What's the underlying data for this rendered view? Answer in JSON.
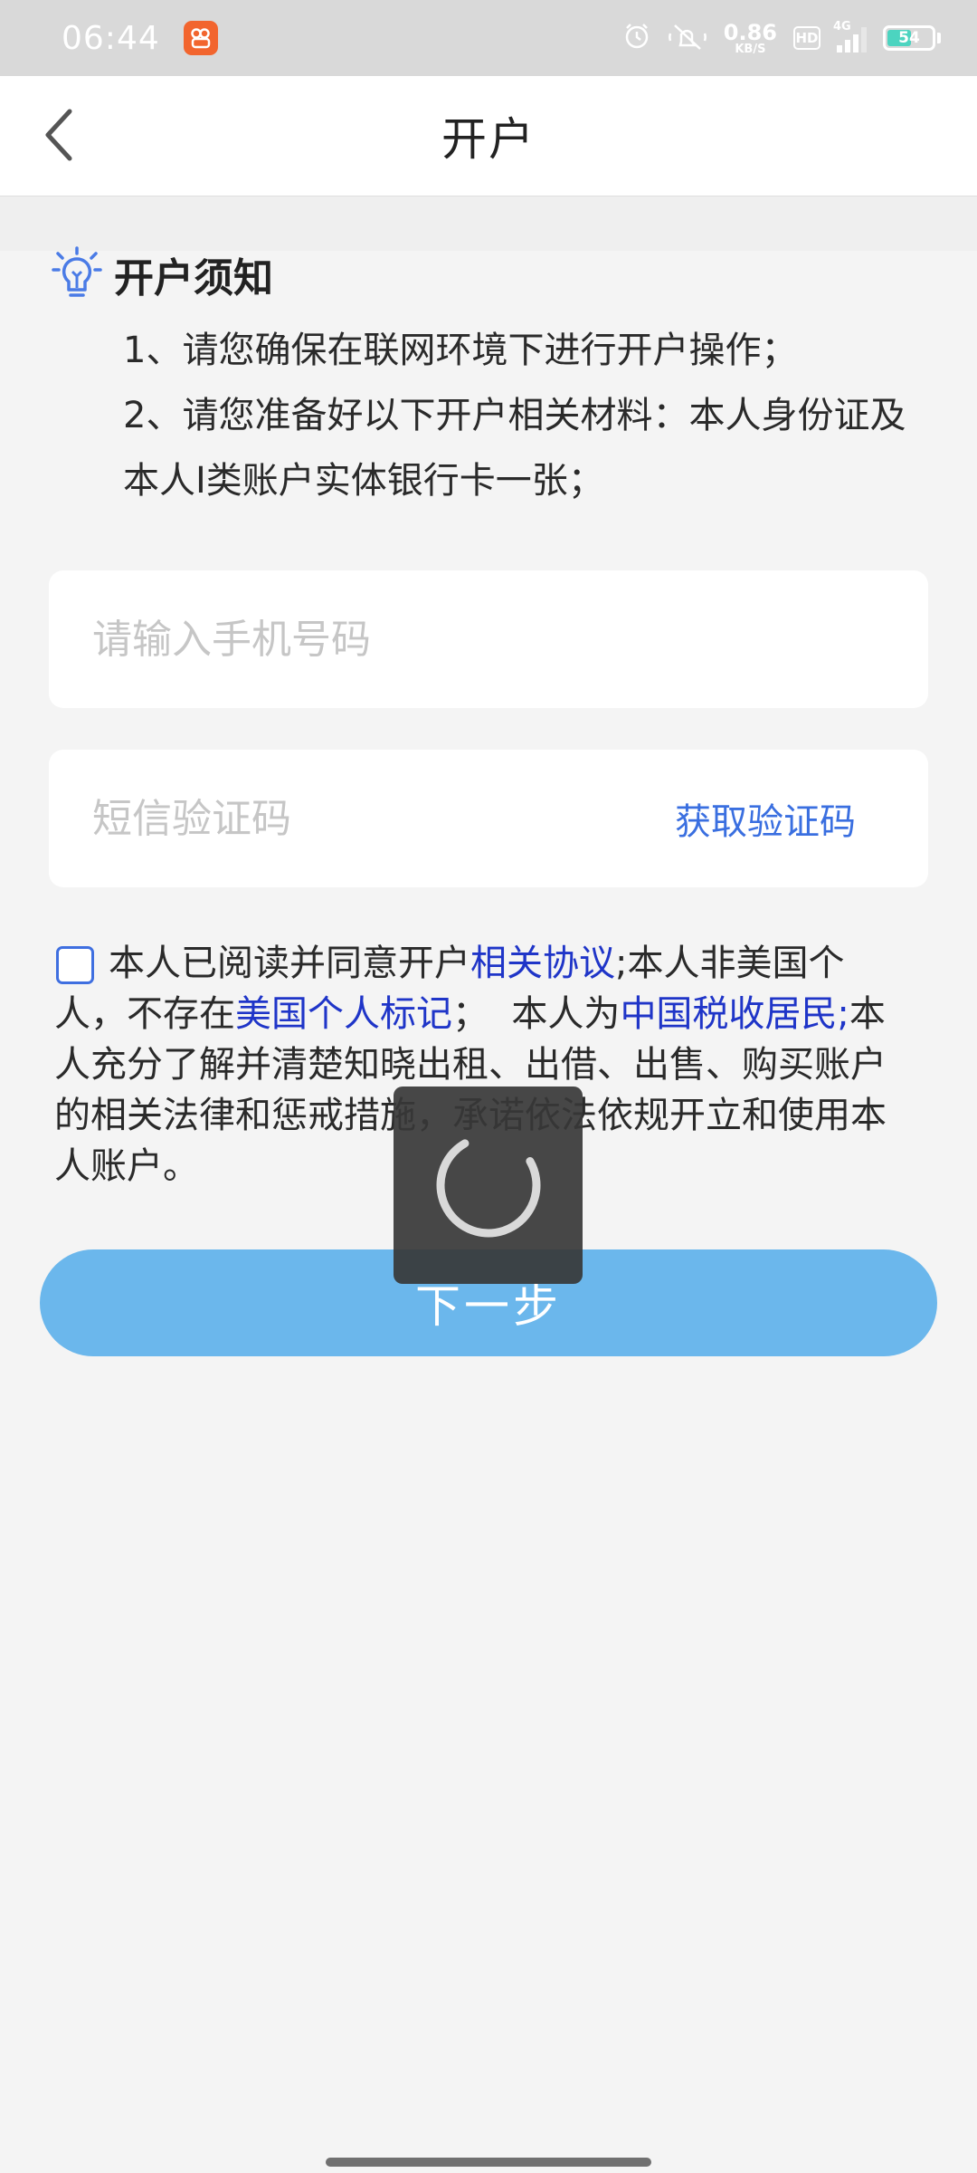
{
  "status_bar": {
    "time": "06:44",
    "net_speed_value": "0.86",
    "net_speed_unit": "KB/S",
    "hd": "HD",
    "network": "4G",
    "battery": "54",
    "battery_level": 0.54,
    "icons": [
      "app-badge-icon",
      "alarm-icon",
      "mute-icon",
      "signal-icon",
      "battery-icon"
    ]
  },
  "nav": {
    "title": "开户",
    "back_icon": "chevron-left-icon"
  },
  "notice": {
    "title": "开户须知",
    "icon": "lightbulb-icon",
    "items": [
      "1、请您确保在联网环境下进行开户操作；",
      "2、请您准备好以下开户相关材料：本人身份证及本人I类账户实体银行卡一张；"
    ]
  },
  "form": {
    "phone_placeholder": "请输入手机号码",
    "sms_placeholder": "短信验证码",
    "get_code_label": "获取验证码"
  },
  "agreement": {
    "checked": false,
    "text_1": "本人已阅读并同意开户",
    "link_1": "相关协议",
    "text_2": ";本人非美国个人，不存在",
    "link_2": "美国个人标记",
    "text_3": "；  本人为",
    "link_3": "中国税收居民;",
    "text_4": "本人充分了解并清楚知晓出租、出借、出售、购买账户的相关法律和惩戒措施，承诺依法依规开立和使用本人账户。"
  },
  "next_button_label": "下一步",
  "colors": {
    "accent_blue": "#3a6fe0",
    "link_blue": "#1f35c8",
    "button_blue": "#6bb7ec",
    "background": "#f4f4f4"
  }
}
